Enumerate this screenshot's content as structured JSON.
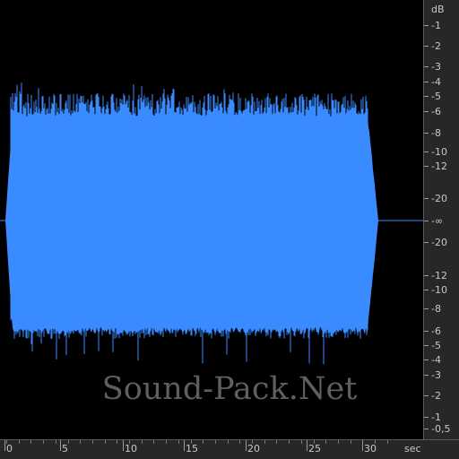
{
  "colors": {
    "background": "#000000",
    "waveform": "#3a8bff",
    "ruler_bg": "#272727",
    "ruler_text": "#c8c8c8",
    "watermark": "#6a6a6a"
  },
  "db_scale": {
    "unit": "dB",
    "labels": [
      "-1",
      "-2",
      "-3",
      "-4",
      "-5",
      "-6",
      "-8",
      "-10",
      "-12",
      "-20",
      "-∞",
      "-20",
      "-12",
      "-10",
      "-8",
      "-6",
      "-5",
      "-4",
      "-3",
      "-2",
      "-1",
      "-0,5"
    ]
  },
  "time_scale": {
    "unit": "sec",
    "labels": [
      "0",
      "5",
      "10",
      "15",
      "20",
      "25",
      "30"
    ]
  },
  "watermark": "Sound-Pack.Net"
}
